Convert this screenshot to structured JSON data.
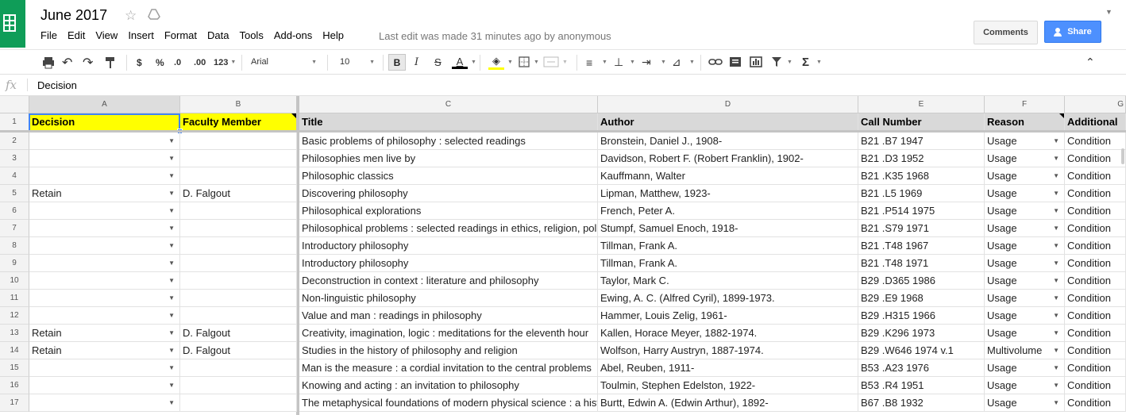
{
  "app": {
    "title": "June 2017",
    "menu": [
      "File",
      "Edit",
      "View",
      "Insert",
      "Format",
      "Data",
      "Tools",
      "Add-ons",
      "Help"
    ],
    "last_edit": "Last edit was made 31 minutes ago by anonymous",
    "comments_label": "Comments",
    "share_label": "Share",
    "brand_color": "#0f9d58",
    "share_color": "#4d90fe"
  },
  "toolbar": {
    "currency": "$",
    "percent": "%",
    "dec_decrease": ".0",
    "dec_increase": ".00",
    "more_formats": "123",
    "font": "Arial",
    "font_size": "10",
    "bold": "B",
    "italic": "I",
    "strike": "S",
    "text_color": "A",
    "icons": [
      "print-icon",
      "undo-icon",
      "redo-icon",
      "paint-format-icon",
      "fill-color-icon",
      "borders-icon",
      "merge-icon",
      "align-icon",
      "valign-icon",
      "wrap-icon",
      "rotate-icon",
      "link-icon",
      "comment-icon",
      "chart-icon",
      "filter-icon",
      "functions-icon",
      "collapse-toolbar-icon"
    ]
  },
  "formula_bar": {
    "fx": "fx",
    "value": "Decision"
  },
  "columns": [
    "A",
    "B",
    "C",
    "D",
    "E",
    "F",
    "G"
  ],
  "header_row": {
    "row": "1",
    "cells": [
      "Decision",
      "Faculty Member",
      "Title",
      "Author",
      "Call Number",
      "Reason",
      "Additional"
    ]
  },
  "rows": [
    {
      "n": "2",
      "decision": "",
      "faculty": "",
      "title": "Basic problems of philosophy : selected readings",
      "author": "Bronstein, Daniel J., 1908-",
      "call": "B21 .B7 1947",
      "reason": "Usage",
      "additional": "Condition"
    },
    {
      "n": "3",
      "decision": "",
      "faculty": "",
      "title": "Philosophies men live by",
      "author": "Davidson, Robert F. (Robert Franklin), 1902-",
      "call": "B21 .D3 1952",
      "reason": "Usage",
      "additional": "Condition"
    },
    {
      "n": "4",
      "decision": "",
      "faculty": "",
      "title": "Philosophic classics",
      "author": "Kauffmann, Walter",
      "call": "B21 .K35 1968",
      "reason": "Usage",
      "additional": "Condition"
    },
    {
      "n": "5",
      "decision": "Retain",
      "faculty": "D. Falgout",
      "title": "Discovering philosophy",
      "author": "Lipman, Matthew, 1923-",
      "call": "B21 .L5 1969",
      "reason": "Usage",
      "additional": "Condition"
    },
    {
      "n": "6",
      "decision": "",
      "faculty": "",
      "title": "Philosophical explorations",
      "author": "French, Peter A.",
      "call": "B21 .P514 1975",
      "reason": "Usage",
      "additional": "Condition"
    },
    {
      "n": "7",
      "decision": "",
      "faculty": "",
      "title": "Philosophical problems : selected readings in ethics, religion, pol",
      "author": "Stumpf, Samuel Enoch, 1918-",
      "call": "B21 .S79 1971",
      "reason": "Usage",
      "additional": "Condition"
    },
    {
      "n": "8",
      "decision": "",
      "faculty": "",
      "title": "Introductory philosophy",
      "author": "Tillman, Frank A.",
      "call": "B21 .T48 1967",
      "reason": "Usage",
      "additional": "Condition"
    },
    {
      "n": "9",
      "decision": "",
      "faculty": "",
      "title": "Introductory philosophy",
      "author": "Tillman, Frank A.",
      "call": "B21 .T48 1971",
      "reason": "Usage",
      "additional": "Condition"
    },
    {
      "n": "10",
      "decision": "",
      "faculty": "",
      "title": "Deconstruction in context : literature and philosophy",
      "author": "Taylor, Mark C.",
      "call": "B29 .D365 1986",
      "reason": "Usage",
      "additional": "Condition"
    },
    {
      "n": "11",
      "decision": "",
      "faculty": "",
      "title": "Non-linguistic philosophy",
      "author": "Ewing, A. C. (Alfred Cyril), 1899-1973.",
      "call": "B29 .E9 1968",
      "reason": "Usage",
      "additional": "Condition"
    },
    {
      "n": "12",
      "decision": "",
      "faculty": "",
      "title": "Value and man : readings in philosophy",
      "author": "Hammer, Louis Zelig, 1961-",
      "call": "B29 .H315 1966",
      "reason": "Usage",
      "additional": "Condition"
    },
    {
      "n": "13",
      "decision": "Retain",
      "faculty": "D. Falgout",
      "title": "Creativity, imagination, logic : meditations for the eleventh hour",
      "author": "Kallen, Horace Meyer, 1882-1974.",
      "call": "B29 .K296 1973",
      "reason": "Usage",
      "additional": "Condition"
    },
    {
      "n": "14",
      "decision": "Retain",
      "faculty": "D. Falgout",
      "title": "Studies in the history of philosophy and religion",
      "author": "Wolfson, Harry Austryn, 1887-1974.",
      "call": "B29 .W646 1974 v.1",
      "reason": "Multivolume",
      "additional": "Condition"
    },
    {
      "n": "15",
      "decision": "",
      "faculty": "",
      "title": "Man is the measure : a cordial invitation to the central problems",
      "author": "Abel, Reuben, 1911-",
      "call": "B53 .A23 1976",
      "reason": "Usage",
      "additional": "Condition"
    },
    {
      "n": "16",
      "decision": "",
      "faculty": "",
      "title": "Knowing and acting : an invitation to philosophy",
      "author": "Toulmin, Stephen Edelston, 1922-",
      "call": "B53 .R4 1951",
      "reason": "Usage",
      "additional": "Condition"
    },
    {
      "n": "17",
      "decision": "",
      "faculty": "",
      "title": "The metaphysical foundations of modern physical science : a hist",
      "author": "Burtt, Edwin A. (Edwin Arthur), 1892-",
      "call": "B67 .B8 1932",
      "reason": "Usage",
      "additional": "Condition"
    }
  ],
  "colors": {
    "header_yellow": "#ffff00",
    "header_gray": "#d9d9d9",
    "selection_blue": "#4285f4"
  }
}
